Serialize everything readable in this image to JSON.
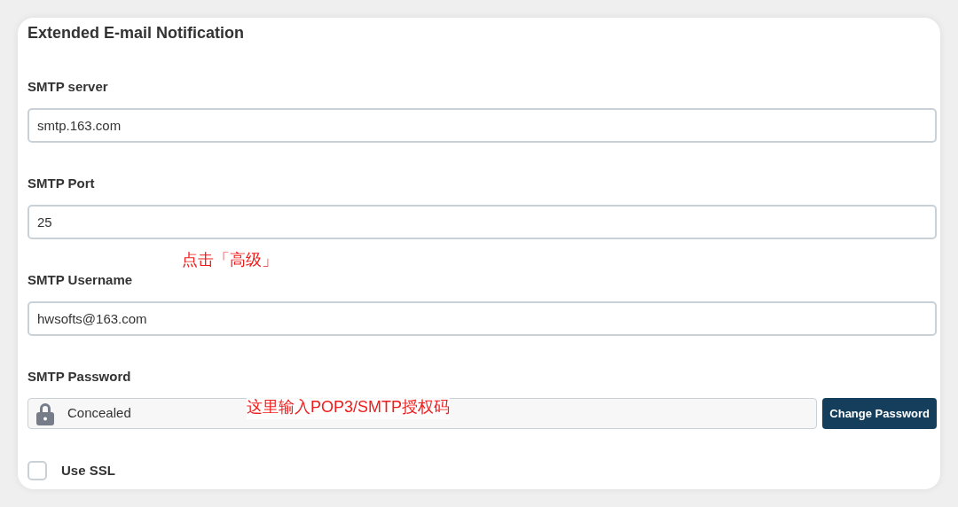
{
  "title": "Extended E-mail Notification",
  "fields": [
    {
      "kind": "text",
      "label": "SMTP server",
      "value": "smtp.163.com"
    },
    {
      "kind": "text",
      "label": "SMTP Port",
      "value": "25"
    },
    {
      "kind": "text",
      "label": "SMTP Username",
      "value": "hwsofts@163.com"
    },
    {
      "kind": "password",
      "label": "SMTP Password",
      "value": "Concealed",
      "button": "Change Password"
    }
  ],
  "checkbox": {
    "label": "Use SSL",
    "checked": false
  },
  "annotations": [
    "点击「高级」",
    "这里输入POP3/SMTP授权码"
  ]
}
